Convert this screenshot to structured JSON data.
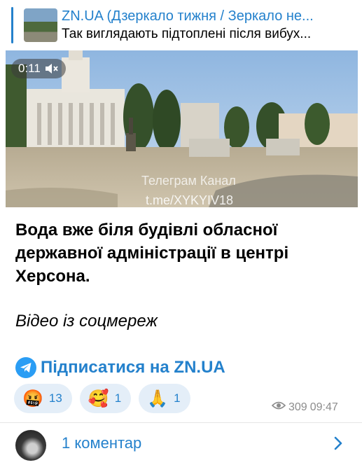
{
  "reply": {
    "channel": "ZN.UA (Дзеркало тижня / Зеркало не...",
    "text": "Так виглядають підтоплені після вибух..."
  },
  "video": {
    "timer": "0:11",
    "watermark_line1": "Телеграм Канал",
    "watermark_line2": "t.me/XYKYIV18"
  },
  "message": {
    "text": "Вода вже біля будівлі обласної державної адміністрації в центрі Херсона.",
    "italic": "Відео із соцмереж",
    "subscribe": "Підписатися на ZN.UA"
  },
  "reactions": [
    {
      "emoji": "🤬",
      "count": "13"
    },
    {
      "emoji": "🥰",
      "count": "1"
    },
    {
      "emoji": "🙏",
      "count": "1"
    }
  ],
  "meta": {
    "views": "309",
    "time": "09:47"
  },
  "comments": {
    "label": "1 коментар"
  },
  "colors": {
    "accent": "#2481cc",
    "reaction_bg": "#e4eef8"
  }
}
